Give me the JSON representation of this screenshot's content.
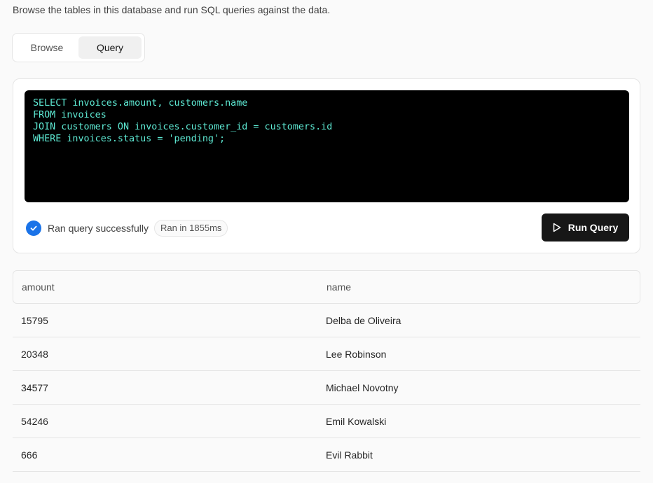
{
  "intro": "Browse the tables in this database and run SQL queries against the data.",
  "tabs": [
    {
      "label": "Browse",
      "active": false
    },
    {
      "label": "Query",
      "active": true
    }
  ],
  "editor": {
    "query": "SELECT invoices.amount, customers.name\nFROM invoices\nJOIN customers ON invoices.customer_id = customers.id\nWHERE invoices.status = 'pending';"
  },
  "status": {
    "icon": "check-circle-icon",
    "text": "Ran query successfully",
    "badge": "Ran in 1855ms"
  },
  "run_button": {
    "label": "Run Query",
    "icon": "play-icon"
  },
  "table": {
    "headers": [
      "amount",
      "name"
    ],
    "rows": [
      [
        "15795",
        "Delba de Oliveira"
      ],
      [
        "20348",
        "Lee Robinson"
      ],
      [
        "34577",
        "Michael Novotny"
      ],
      [
        "54246",
        "Emil Kowalski"
      ],
      [
        "666",
        "Evil Rabbit"
      ]
    ]
  },
  "colors": {
    "accent": "#1a73e8",
    "code_text": "#5eead4",
    "editor_bg": "#000000",
    "button_bg": "#171717"
  }
}
